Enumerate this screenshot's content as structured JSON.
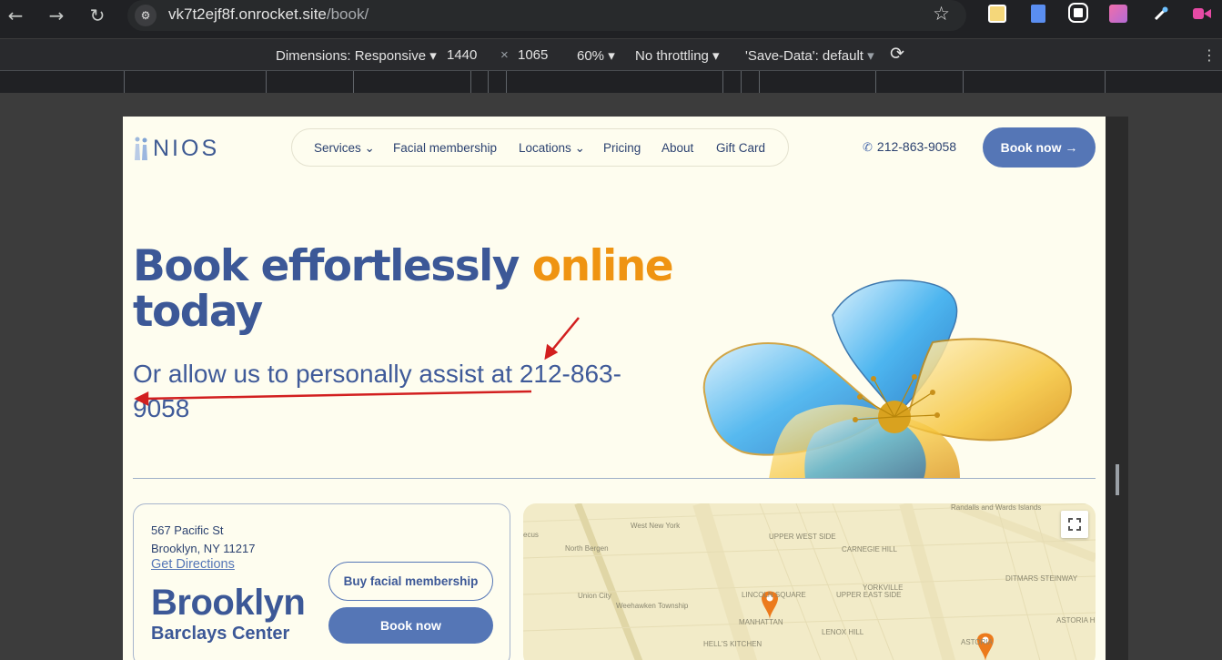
{
  "browser": {
    "url_host": "vk7t2ejf8f.onrocket.site",
    "url_path": "/book/",
    "nav_icons": [
      "back-icon",
      "forward-icon",
      "reload-icon"
    ],
    "site_info_icon": "tune-icon",
    "bookmark_icon": "star-icon"
  },
  "devtools": {
    "dimensions_label": "Dimensions: Responsive",
    "width": "1440",
    "times": "×",
    "height": "1065",
    "zoom": "60%",
    "throttling": "No throttling",
    "save_data": "'Save-Data': default"
  },
  "site": {
    "logo_text": "NIOS",
    "nav": [
      "Services",
      "Facial membership",
      "Locations",
      "Pricing",
      "About",
      "Gift Card"
    ],
    "phone": "212-863-9058",
    "book_now": "Book now",
    "book_arrow": "→"
  },
  "hero": {
    "title_main": "Book effortlessly",
    "title_accent": "online",
    "title_end": "today",
    "subtitle_prefix": "Or allow us to personally assist at ",
    "subtitle_phone": "212-863-9058"
  },
  "location": {
    "street": "567 Pacific St",
    "city_line": "Brooklyn, NY 11217",
    "directions": "Get Directions",
    "city": "Brooklyn",
    "venue": "Barclays Center",
    "membership_button": "Buy facial membership",
    "book_button": "Book now"
  },
  "map": {
    "labels": [
      "Randalls and Wards Islands",
      "West New York",
      "North Bergen",
      "UPPER WEST SIDE",
      "CARNEGIE HILL",
      "DITMARS STEINWAY",
      "Union City",
      "Weehawken Township",
      "LINCOLN SQUARE",
      "UPPER EAST SIDE",
      "YORKVILLE",
      "MANHATTAN",
      "LENOX HILL",
      "HELL'S KITCHEN",
      "ASTORIA HEIGHTS",
      "ASTORIA",
      "ecus"
    ],
    "pin_color": "#ec7a1c"
  },
  "colors": {
    "brand_blue": "#3c5897",
    "button_blue": "#5576b6",
    "accent_orange": "#ef9412",
    "page_bg": "#fefdef",
    "annotation_red": "#d21f1f"
  }
}
